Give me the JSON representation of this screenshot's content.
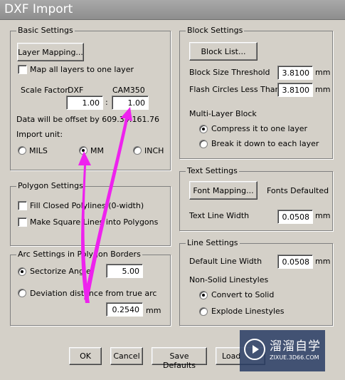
{
  "window": {
    "title": "DXF Import"
  },
  "basic": {
    "legend": "Basic Settings",
    "layer_mapping": "Layer Mapping...",
    "map_all_layers": "Map all layers to one layer",
    "scale_factor_label": "Scale Factor",
    "dxf_label": "DXF",
    "cam_label": "CAM350",
    "dxf_value": "1.00",
    "colon": ":",
    "cam_value": "1.00",
    "offset_text": "Data will be offset by 609.34:161.76",
    "import_unit_label": "Import unit:",
    "units": [
      "MILS",
      "MM",
      "INCH"
    ],
    "selected_unit": "MM"
  },
  "polygon": {
    "legend": "Polygon Settings",
    "fill_closed": "Fill Closed Polylines (0-width)",
    "make_square": "Make Square Lines into Polygons"
  },
  "arc": {
    "legend": "Arc Settings in Polygon Borders",
    "sectorize": "Sectorize Angle",
    "sectorize_value": "5.00",
    "deviation": "Deviation distance from true arc",
    "deviation_value": "0.2540",
    "deviation_unit": "mm"
  },
  "block": {
    "legend": "Block Settings",
    "block_list": "Block List...",
    "size_threshold_label": "Block Size Threshold",
    "size_threshold_value": "3.8100",
    "flash_circles_label": "Flash Circles Less Than",
    "flash_circles_value": "3.8100",
    "unit": "mm",
    "multi_layer_label": "Multi-Layer Block",
    "compress": "Compress it to one layer",
    "break_down": "Break it down to each layer"
  },
  "text": {
    "legend": "Text Settings",
    "font_mapping": "Font Mapping...",
    "fonts_status": "Fonts Defaulted",
    "line_width_label": "Text Line Width",
    "line_width_value": "0.0508",
    "unit": "mm"
  },
  "line": {
    "legend": "Line Settings",
    "default_width_label": "Default Line Width",
    "default_width_value": "0.0508",
    "unit": "mm",
    "non_solid_label": "Non-Solid Linestyles",
    "convert": "Convert to Solid",
    "explode": "Explode Linestyles"
  },
  "buttons": {
    "ok": "OK",
    "cancel": "Cancel",
    "save_defaults": "Save Defaults",
    "load": "Load"
  },
  "watermark": {
    "cn": "溜溜自学",
    "en": "ZIXUE.3D66.COM"
  },
  "colors": {
    "arrow": "#ee22ee",
    "title_bar": "#9a9a9a",
    "dialog": "#d4d0c8"
  }
}
